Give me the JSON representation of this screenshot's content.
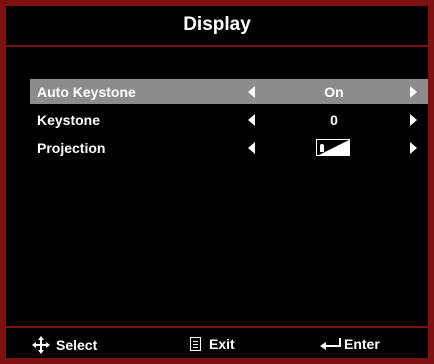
{
  "window": {
    "title": "Display"
  },
  "menu": {
    "items": [
      {
        "label": "Auto Keystone",
        "value": "On",
        "selected": true
      },
      {
        "label": "Keystone",
        "value": "0",
        "selected": false
      },
      {
        "label": "Projection",
        "value": "",
        "icon": "front-desktop-projection-icon",
        "selected": false
      }
    ]
  },
  "footer": {
    "select_label": "Select",
    "exit_label": "Exit",
    "enter_label": "Enter"
  },
  "colors": {
    "border": "#7d1112",
    "highlight": "#8c8c8c",
    "background": "#000000",
    "text": "#ffffff"
  }
}
